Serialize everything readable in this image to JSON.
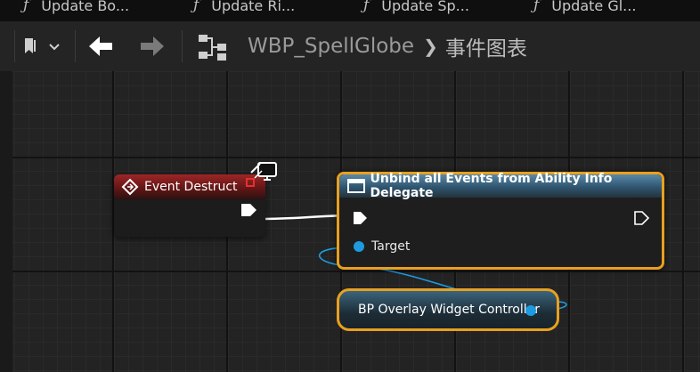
{
  "tabs": [
    {
      "icon": "function-icon",
      "label": "Update Bo..."
    },
    {
      "icon": "function-icon",
      "label": "Update Ri..."
    },
    {
      "icon": "function-icon",
      "label": "Update Sp..."
    },
    {
      "icon": "function-icon",
      "label": "Update Gl..."
    }
  ],
  "breadcrumb": {
    "blueprint": "WBP_SpellGlobe",
    "graph": "事件图表"
  },
  "nodes": {
    "event": {
      "title": "Event Destruct"
    },
    "function": {
      "title": "Unbind all Events from Ability Info Delegate",
      "target_label": "Target"
    },
    "variable": {
      "label": "BP Overlay Widget Controller"
    }
  },
  "colors": {
    "event_header": "#9d2626",
    "function_header": "#2f5570",
    "selection_outline": "#e8a020",
    "object_pin": "#1e9be0",
    "exec_wire": "#ffffff"
  }
}
